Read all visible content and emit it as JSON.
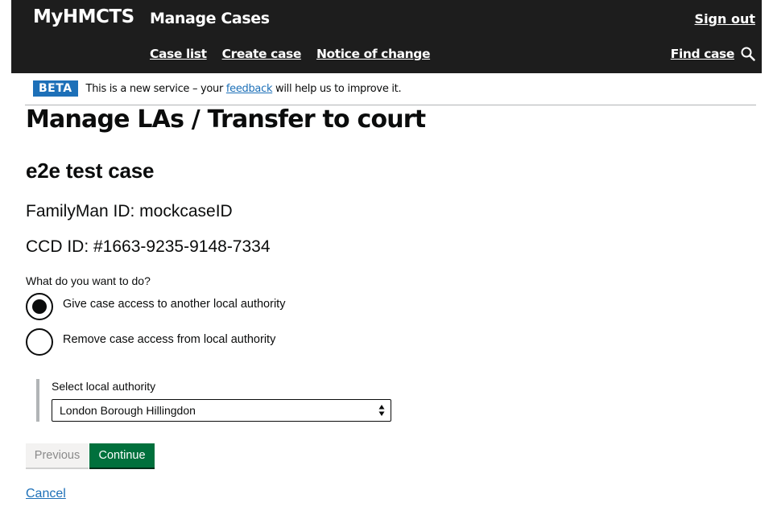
{
  "header": {
    "brand": "MyHMCTS",
    "service": "Manage Cases",
    "sign_out": "Sign out",
    "nav": [
      "Case list",
      "Create case",
      "Notice of change"
    ],
    "find_case": "Find case",
    "find_case_icon": "search-icon"
  },
  "phase_banner": {
    "tag": "BETA",
    "text_before": "This is a new service – your ",
    "link": "feedback",
    "text_after": " will help us to improve it."
  },
  "page": {
    "title": "Manage LAs / Transfer to court",
    "case_name": "e2e test case",
    "familyman": "FamilyMan ID: mockcaseID",
    "ccd": "CCD ID: #1663-9235-9148-7334"
  },
  "form": {
    "question": "What do you want to do?",
    "options": [
      {
        "label": "Give case access to another local authority",
        "selected": true
      },
      {
        "label": "Remove case access from local authority",
        "selected": false
      }
    ],
    "select_label": "Select local authority",
    "select_value": "London Borough Hillingdon"
  },
  "buttons": {
    "previous": "Previous",
    "continue": "Continue",
    "cancel": "Cancel"
  },
  "colors": {
    "header_bg": "#1d1d1d",
    "beta_tag": "#1d70b8",
    "link": "#1d70b8",
    "continue_bg": "#00703c"
  }
}
